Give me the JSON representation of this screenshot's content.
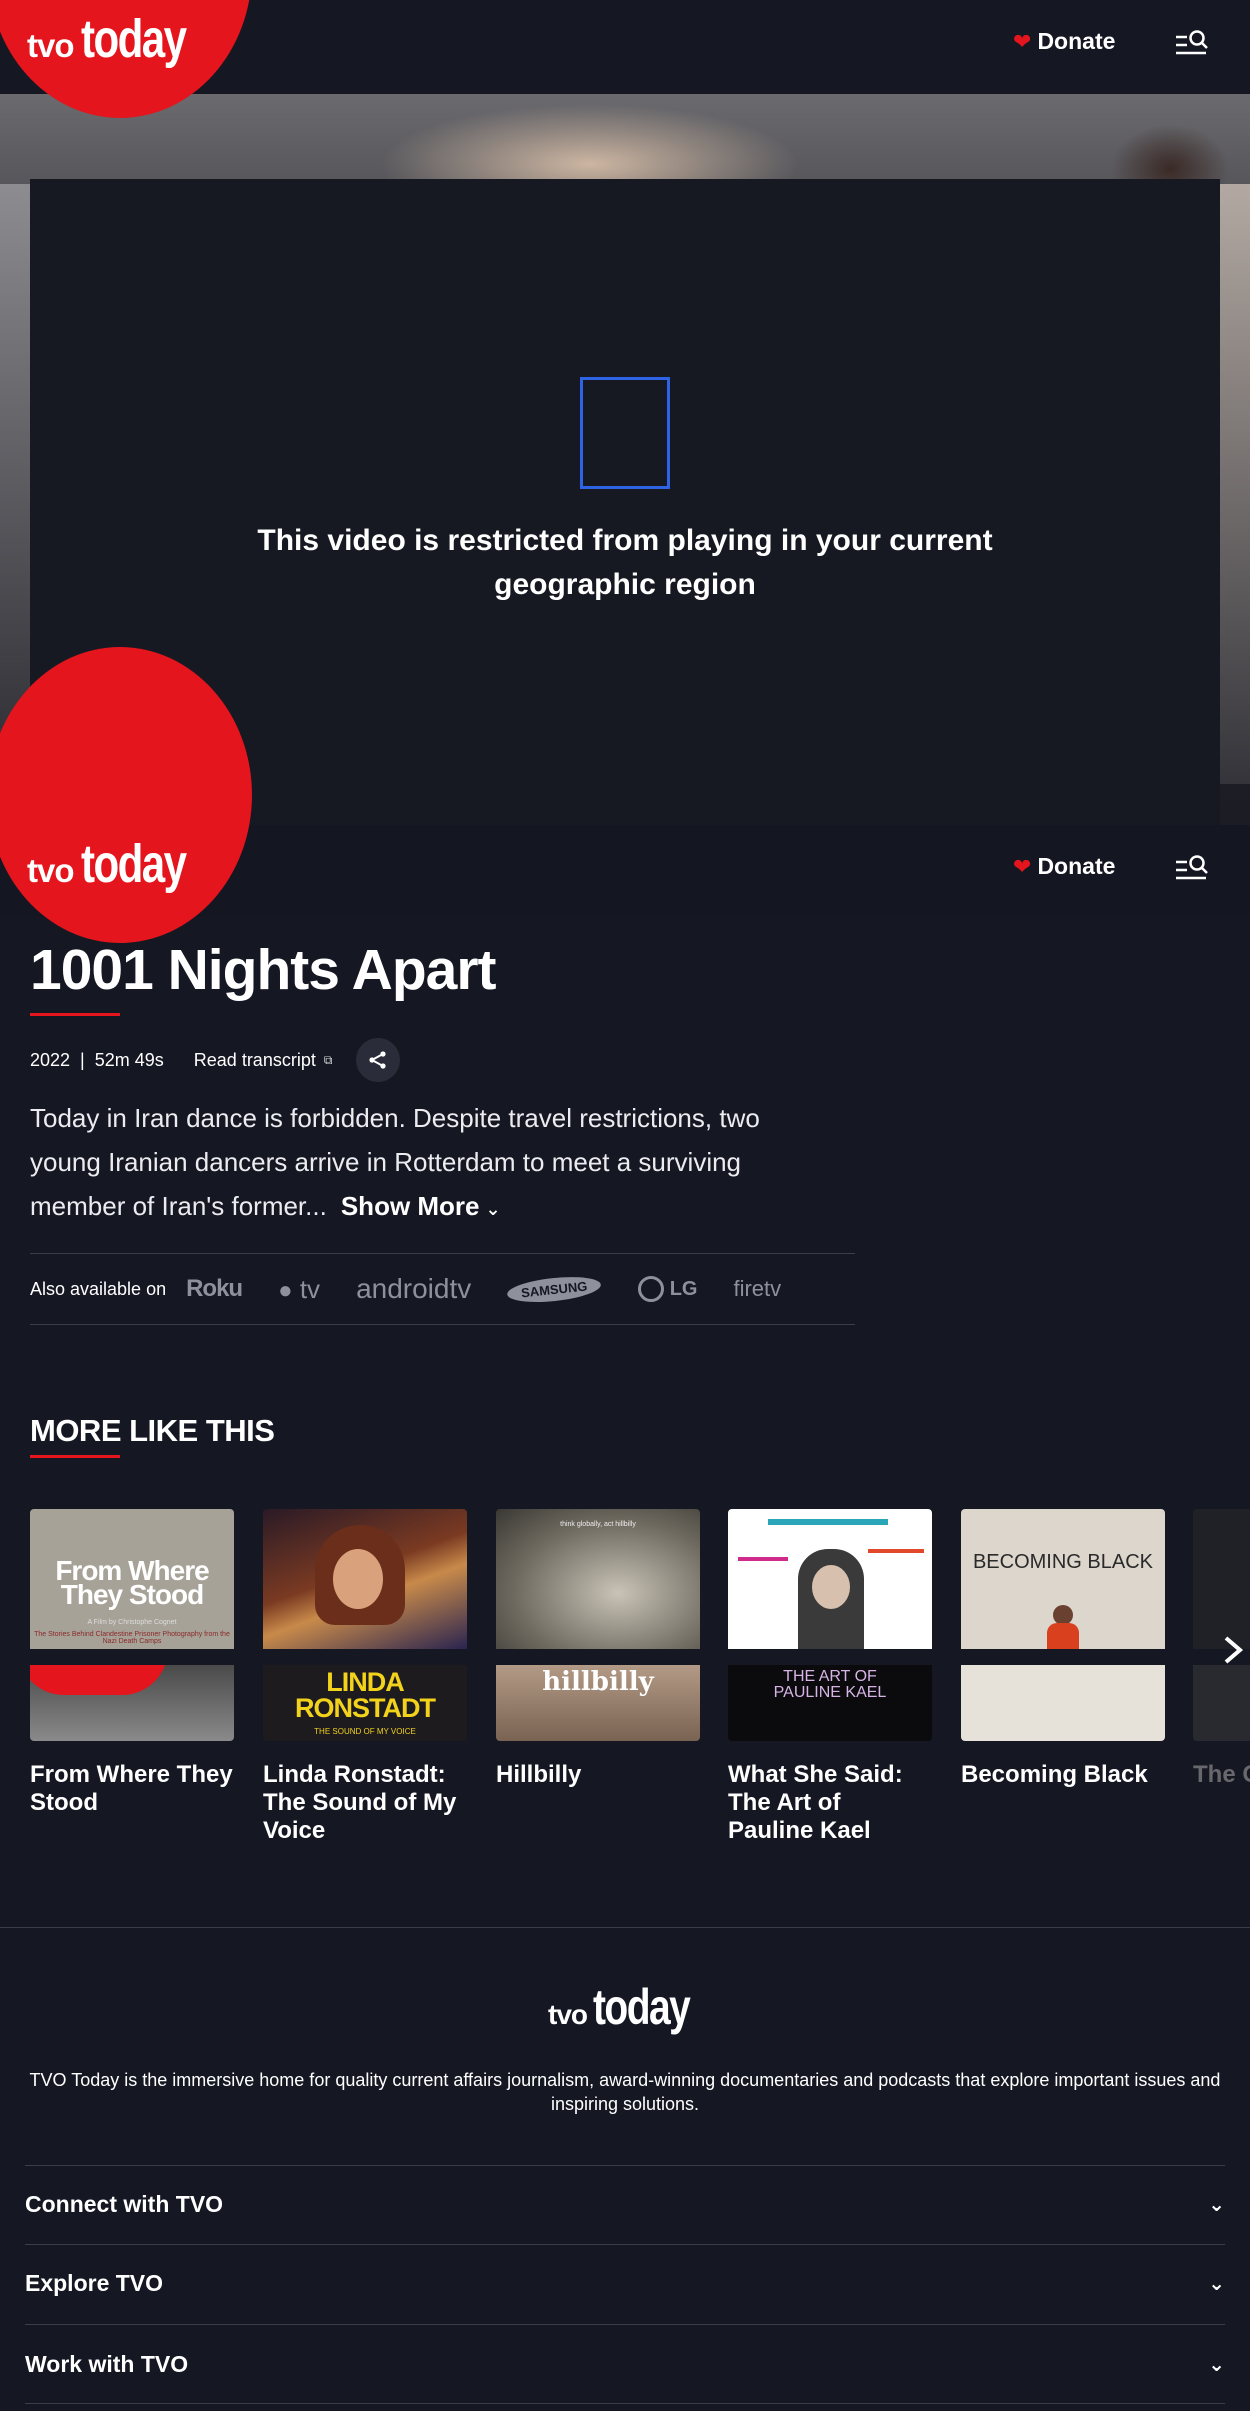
{
  "brand": {
    "logo_small": "tvo",
    "logo_large": "today",
    "red": "#e4151c",
    "background": "#151722"
  },
  "header": {
    "donate_label": "Donate",
    "menu_icon": "menu-search-icon"
  },
  "video": {
    "restricted_message": "This video is restricted from playing in your current geographic region"
  },
  "program": {
    "title": "1001 Nights Apart",
    "year": "2022",
    "separator": "|",
    "duration": "52m 49s",
    "read_transcript": "Read transcript",
    "description": "Today in Iran dance is forbidden. Despite travel restrictions, two young Iranian dancers arrive in Rotterdam to meet a surviving member of Iran's former...",
    "show_more": "Show More"
  },
  "availability": {
    "label": "Also available on",
    "platforms": [
      "Roku",
      "tv",
      "androidtv",
      "SAMSUNG",
      "LG",
      "firetv"
    ]
  },
  "more_like_this": {
    "heading": "MORE LIKE THIS",
    "cards": [
      {
        "title": "From Where They Stood",
        "poster_title": "From Where They Stood",
        "poster_sub": "A Film by Christophe Cognet",
        "poster_caption": "The Stories Behind Clandestine Prisoner Photography from the Nazi Death Camps"
      },
      {
        "title": "Linda Ronstadt: The Sound of My Voice",
        "poster_title": "LINDA RONSTADT",
        "poster_sub": "THE SOUND OF MY VOICE"
      },
      {
        "title": "Hillbilly",
        "poster_title": "hillbilly",
        "poster_top": "think globally, act hillbilly"
      },
      {
        "title": "What She Said: The Art of Pauline Kael",
        "poster_title": "THE ART OF PAULINE KAEL"
      },
      {
        "title": "Becoming Black",
        "poster_title": "BECOMING BLACK"
      },
      {
        "title": "The C… Tone…"
      }
    ]
  },
  "footer": {
    "description": "TVO Today is the immersive home for quality current affairs journalism, award-winning documentaries and podcasts that explore important issues and inspiring solutions.",
    "sections": [
      "Connect with TVO",
      "Explore TVO",
      "Work with TVO"
    ]
  }
}
